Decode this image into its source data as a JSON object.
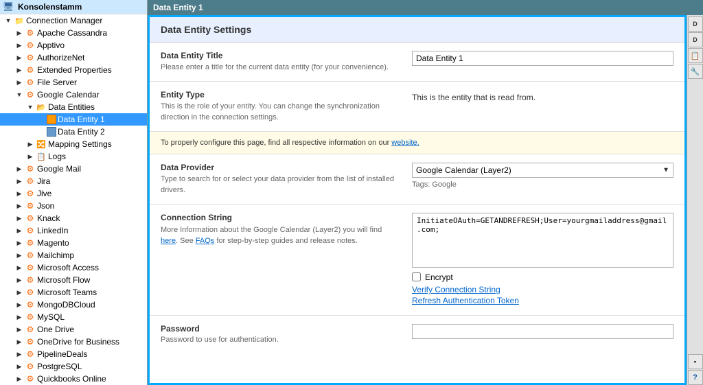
{
  "app": {
    "title": "Data Entity 1"
  },
  "sidebar": {
    "root_label": "Konsolenstamm",
    "items": [
      {
        "id": "connection-manager",
        "label": "Connection Manager",
        "level": 1,
        "expanded": true,
        "type": "folder"
      },
      {
        "id": "apache-cassandra",
        "label": "Apache Cassandra",
        "level": 2,
        "type": "gear"
      },
      {
        "id": "apptivo",
        "label": "Apptivo",
        "level": 2,
        "type": "gear"
      },
      {
        "id": "authorizenet",
        "label": "AuthorizeNet",
        "level": 2,
        "type": "gear"
      },
      {
        "id": "extended-properties",
        "label": "Extended Properties",
        "level": 2,
        "type": "gear"
      },
      {
        "id": "file-server",
        "label": "File Server",
        "level": 2,
        "type": "gear"
      },
      {
        "id": "google-calendar",
        "label": "Google Calendar",
        "level": 2,
        "type": "gear",
        "expanded": true
      },
      {
        "id": "data-entities",
        "label": "Data Entities",
        "level": 3,
        "type": "folder",
        "expanded": true
      },
      {
        "id": "data-entity-1",
        "label": "Data Entity 1",
        "level": 4,
        "type": "page-selected",
        "selected": true
      },
      {
        "id": "data-entity-2",
        "label": "Data Entity 2",
        "level": 4,
        "type": "page"
      },
      {
        "id": "mapping-settings",
        "label": "Mapping Settings",
        "level": 3,
        "type": "mapping"
      },
      {
        "id": "logs",
        "label": "Logs",
        "level": 3,
        "type": "logs"
      },
      {
        "id": "google-mail",
        "label": "Google Mail",
        "level": 2,
        "type": "gear"
      },
      {
        "id": "jira",
        "label": "Jira",
        "level": 2,
        "type": "gear"
      },
      {
        "id": "jive",
        "label": "Jive",
        "level": 2,
        "type": "gear"
      },
      {
        "id": "json",
        "label": "Json",
        "level": 2,
        "type": "gear"
      },
      {
        "id": "knack",
        "label": "Knack",
        "level": 2,
        "type": "gear"
      },
      {
        "id": "linkedin",
        "label": "LinkedIn",
        "level": 2,
        "type": "gear"
      },
      {
        "id": "magento",
        "label": "Magento",
        "level": 2,
        "type": "gear"
      },
      {
        "id": "mailchimp",
        "label": "Mailchimp",
        "level": 2,
        "type": "gear"
      },
      {
        "id": "microsoft-access",
        "label": "Microsoft Access",
        "level": 2,
        "type": "gear"
      },
      {
        "id": "microsoft-flow",
        "label": "Microsoft Flow",
        "level": 2,
        "type": "gear"
      },
      {
        "id": "microsoft-teams",
        "label": "Microsoft Teams",
        "level": 2,
        "type": "gear"
      },
      {
        "id": "mongodbcloud",
        "label": "MongoDBCloud",
        "level": 2,
        "type": "gear"
      },
      {
        "id": "mysql",
        "label": "MySQL",
        "level": 2,
        "type": "gear"
      },
      {
        "id": "one-drive",
        "label": "One Drive",
        "level": 2,
        "type": "gear"
      },
      {
        "id": "onedrive-business",
        "label": "OneDrive for Business",
        "level": 2,
        "type": "gear"
      },
      {
        "id": "pipelinedeals",
        "label": "PipelineDeals",
        "level": 2,
        "type": "gear"
      },
      {
        "id": "postgresql",
        "label": "PostgreSQL",
        "level": 2,
        "type": "gear"
      },
      {
        "id": "quickbooks-online",
        "label": "Quickbooks Online",
        "level": 2,
        "type": "gear"
      }
    ]
  },
  "main": {
    "window_title": "Data Entity 1",
    "settings_title": "Data Entity Settings",
    "sections": {
      "entity_title": {
        "label": "Data Entity Title",
        "description": "Please enter a title for the current data entity (for your convenience).",
        "value": "Data Entity 1"
      },
      "entity_type": {
        "label": "Entity Type",
        "description": "This is the role of your entity. You can change the synchronization direction in the connection settings.",
        "value": "This is the entity that is read from."
      },
      "info_banner": {
        "text": "To properly configure this page, find all respective information on our ",
        "link_text": "website."
      },
      "data_provider": {
        "label": "Data Provider",
        "description": "Type to search for or select your data provider from the list of installed drivers.",
        "value": "Google Calendar (Layer2)",
        "options": [
          "Google Calendar (Layer2)"
        ],
        "tags": "Tags: Google"
      },
      "connection_string": {
        "label": "Connection String",
        "description_prefix": "More Information about the Google Calendar (Layer2) you will find ",
        "here_link": "here",
        "description_mid": ". See ",
        "faqs_link": "FAQs",
        "description_suffix": " for step-by-step guides and release notes.",
        "value": "InitiateOAuth=GETANDREFRESH;User=yourgmailaddress@gmail.com;",
        "encrypt_label": "Encrypt",
        "verify_link": "Verify Connection String",
        "refresh_link": "Refresh Authentication Token"
      },
      "password": {
        "label": "Password",
        "description": "Password to use for authentication.",
        "value": ""
      }
    }
  },
  "toolbar": {
    "buttons": [
      "D",
      "D",
      "📋",
      "🔧",
      "❓"
    ]
  }
}
